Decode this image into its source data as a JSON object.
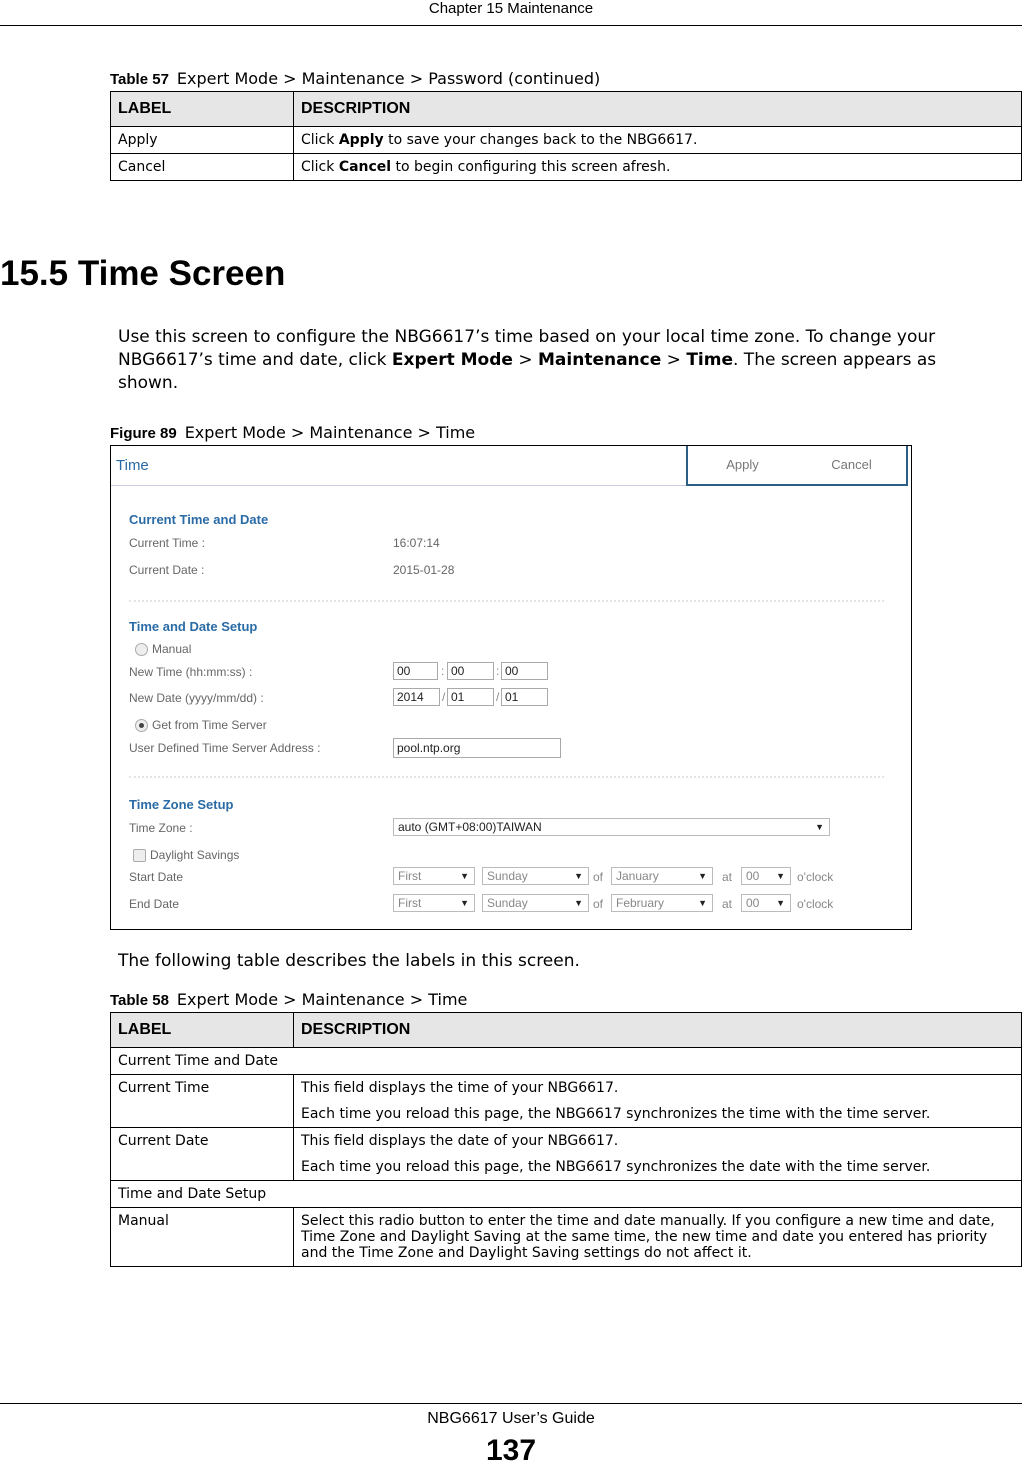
{
  "running_header": "Chapter 15 Maintenance",
  "table57": {
    "number": "Table 57",
    "title": "Expert Mode > Maintenance > Password (continued)",
    "headers": [
      "LABEL",
      "DESCRIPTION"
    ],
    "rows": [
      {
        "label": "Apply",
        "pre": "Click ",
        "bold": "Apply",
        "post": " to save your changes back to the NBG6617."
      },
      {
        "label": "Cancel",
        "pre": "Click ",
        "bold": "Cancel",
        "post": " to begin configuring this screen afresh."
      }
    ]
  },
  "section": {
    "heading": "15.5  Time Screen",
    "intro": {
      "t1": "Use this screen to configure the NBG6617’s time based on your local time zone. To change your NBG6617’s time and date, click ",
      "b1": "Expert Mode",
      "t2": " > ",
      "b2": "Maintenance",
      "t3": " > ",
      "b3": "Time",
      "t4": ". The screen appears as shown."
    }
  },
  "figure": {
    "number": "Figure 89",
    "caption": "Expert Mode > Maintenance > Time",
    "screen": {
      "title": "Time",
      "apply": "Apply",
      "cancel": "Cancel",
      "current": {
        "heading": "Current Time and Date",
        "time_label": "Current Time :",
        "time_value": "16:07:14",
        "date_label": "Current Date :",
        "date_value": "2015-01-28"
      },
      "setup": {
        "heading": "Time and Date Setup",
        "manual_label": "Manual",
        "manual_selected": false,
        "new_time_label": "New Time (hh:mm:ss) :",
        "hh": "00",
        "mm": "00",
        "ss": "00",
        "new_date_label": "New Date (yyyy/mm/dd) :",
        "yyyy": "2014",
        "month": "01",
        "day": "01",
        "server_label": "Get from Time Server",
        "server_selected": true,
        "server_addr_label": "User Defined Time Server Address :",
        "server_addr": "pool.ntp.org"
      },
      "zone": {
        "heading": "Time Zone Setup",
        "zone_label": "Time Zone :",
        "zone_value": "auto (GMT+08:00)TAIWAN",
        "dst_label": "Daylight Savings",
        "dst_checked": false,
        "start_label": "Start Date",
        "end_label": "End Date",
        "of": "of",
        "at": "at",
        "oclock": "o'clock",
        "start": {
          "week": "First",
          "day": "Sunday",
          "month": "January",
          "hour": "00"
        },
        "end": {
          "week": "First",
          "day": "Sunday",
          "month": "February",
          "hour": "00"
        }
      }
    }
  },
  "table_intro": "The following table describes the labels in this screen.",
  "table58": {
    "number": "Table 58",
    "title": "Expert Mode > Maintenance > Time",
    "headers": [
      "LABEL",
      "DESCRIPTION"
    ],
    "section1": "Current Time and Date",
    "row_time": {
      "label": "Current Time",
      "p1": "This field displays the time of your NBG6617.",
      "p2": "Each time you reload this page, the NBG6617 synchronizes the time with the time server."
    },
    "row_date": {
      "label": "Current Date",
      "p1": "This field displays the date of your NBG6617.",
      "p2": "Each time you reload this page, the NBG6617 synchronizes the date with the time server."
    },
    "section2": "Time and Date Setup",
    "row_manual": {
      "label": "Manual",
      "p1": "Select this radio button to enter the time and date manually. If you configure a new time and date, Time Zone and Daylight Saving at the same time, the new time and date you entered has priority and the Time Zone and Daylight Saving settings do not affect it."
    }
  },
  "footer": {
    "guide": "NBG6617 User’s Guide",
    "page": "137"
  }
}
